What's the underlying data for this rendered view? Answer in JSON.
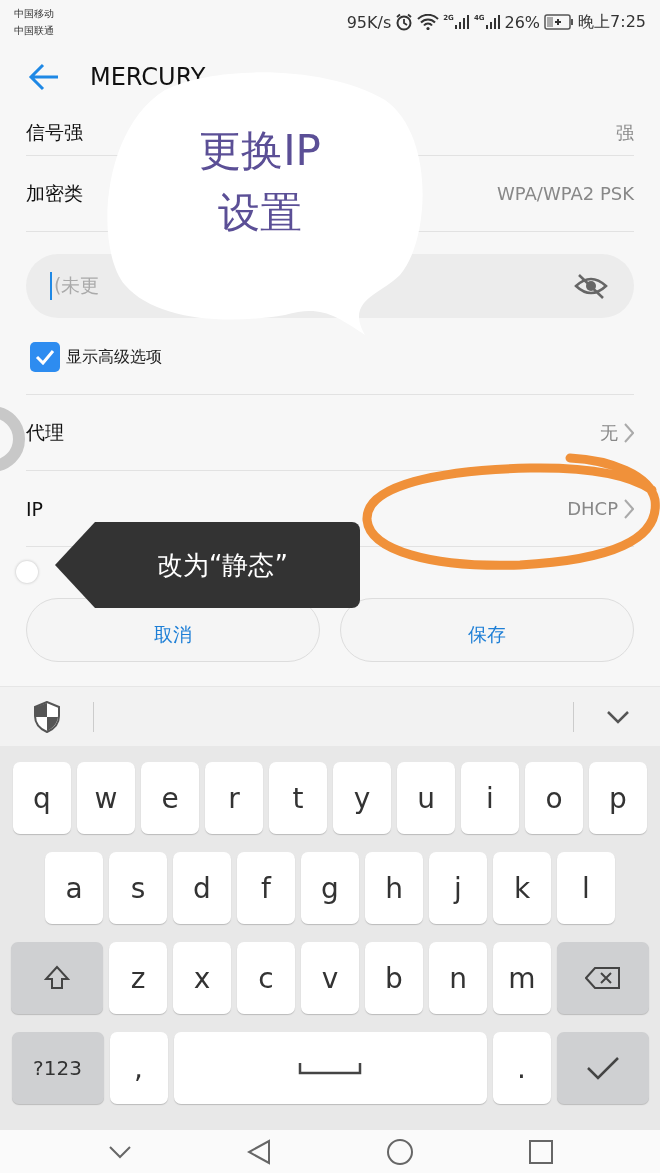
{
  "status_bar": {
    "carriers": [
      "中国移动",
      "中国联通"
    ],
    "speed": "95K/s",
    "network_labels": [
      "2G",
      "4G"
    ],
    "battery": "26%",
    "time": "晚上7:25"
  },
  "app_bar": {
    "title": "MERCURY"
  },
  "info_rows": [
    {
      "label": "信号强",
      "value": "强"
    },
    {
      "label": "加密类",
      "value": "WPA/WPA2 PSK"
    }
  ],
  "password_field": {
    "placeholder": "(未更"
  },
  "advanced_checkbox": {
    "label": "显示高级选项",
    "checked": true
  },
  "option_rows": [
    {
      "label": "代理",
      "value": "无"
    },
    {
      "label": "IP",
      "value": "DHCP"
    }
  ],
  "buttons": [
    "取消",
    "保存"
  ],
  "keyboard": {
    "rows": [
      {
        "keys": [
          {
            "kind": "char",
            "label": "q"
          },
          {
            "kind": "char",
            "label": "w"
          },
          {
            "kind": "char",
            "label": "e"
          },
          {
            "kind": "char",
            "label": "r"
          },
          {
            "kind": "char",
            "label": "t"
          },
          {
            "kind": "char",
            "label": "y"
          },
          {
            "kind": "char",
            "label": "u"
          },
          {
            "kind": "char",
            "label": "i"
          },
          {
            "kind": "char",
            "label": "o"
          },
          {
            "kind": "char",
            "label": "p"
          }
        ]
      },
      {
        "keys": [
          {
            "kind": "char",
            "label": "a"
          },
          {
            "kind": "char",
            "label": "s"
          },
          {
            "kind": "char",
            "label": "d"
          },
          {
            "kind": "char",
            "label": "f"
          },
          {
            "kind": "char",
            "label": "g"
          },
          {
            "kind": "char",
            "label": "h"
          },
          {
            "kind": "char",
            "label": "j"
          },
          {
            "kind": "char",
            "label": "k"
          },
          {
            "kind": "char",
            "label": "l"
          }
        ]
      },
      {
        "keys": [
          {
            "kind": "shift"
          },
          {
            "kind": "char",
            "label": "z"
          },
          {
            "kind": "char",
            "label": "x"
          },
          {
            "kind": "char",
            "label": "c"
          },
          {
            "kind": "char",
            "label": "v"
          },
          {
            "kind": "char",
            "label": "b"
          },
          {
            "kind": "char",
            "label": "n"
          },
          {
            "kind": "char",
            "label": "m"
          },
          {
            "kind": "backspace"
          }
        ]
      },
      {
        "keys": [
          {
            "kind": "mode",
            "label": "?123"
          },
          {
            "kind": "char",
            "label": ","
          },
          {
            "kind": "space"
          },
          {
            "kind": "char",
            "label": "."
          },
          {
            "kind": "enter"
          }
        ]
      }
    ]
  },
  "annotations": {
    "bubble_lines": [
      "更换IP",
      "设置"
    ],
    "tooltip": "改为“静态”"
  }
}
